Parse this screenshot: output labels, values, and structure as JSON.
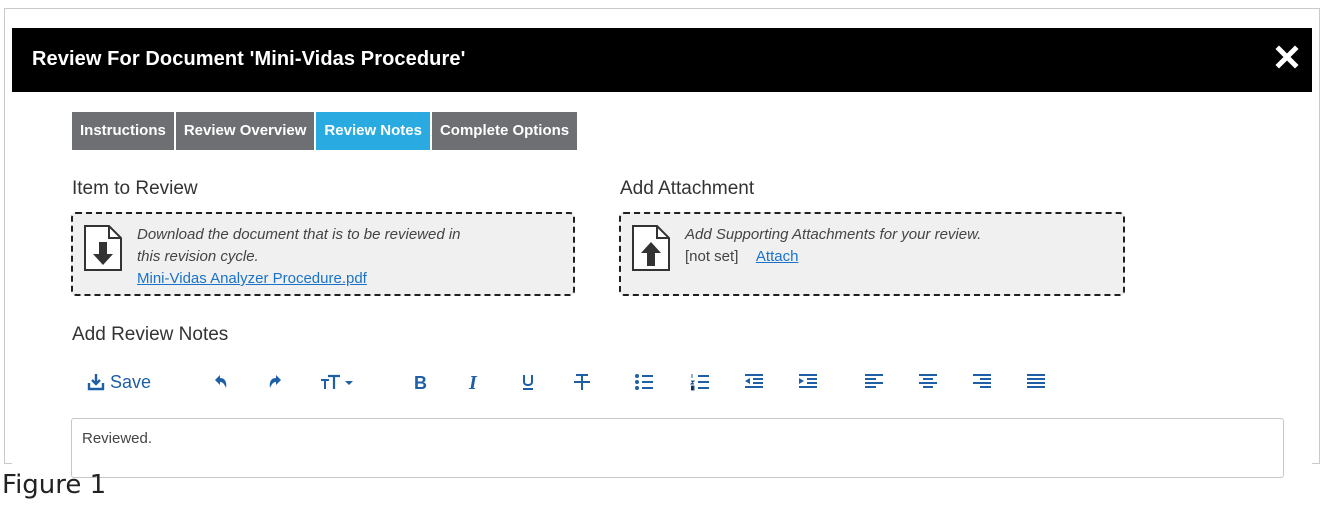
{
  "dialog": {
    "title": "Review For Document 'Mini-Vidas Procedure'",
    "close_icon": "close-icon"
  },
  "tabs": [
    {
      "label": "Instructions",
      "active": false
    },
    {
      "label": "Review Overview",
      "active": false
    },
    {
      "label": "Review Notes",
      "active": true
    },
    {
      "label": "Complete Options",
      "active": false
    }
  ],
  "item_to_review": {
    "heading": "Item to Review",
    "description_line1": "Download the document that is to be reviewed in",
    "description_line2": "this revision cycle.",
    "file_link": "Mini-Vidas Analyzer Procedure.pdf",
    "icon": "download-document-icon"
  },
  "add_attachment": {
    "heading": "Add Attachment",
    "description": "Add Supporting Attachments for your review.",
    "status": "[not set]",
    "attach_link": "Attach",
    "icon": "upload-document-icon"
  },
  "notes": {
    "heading": "Add Review Notes",
    "save_label": "Save",
    "editor_value": "Reviewed.",
    "toolbar_icons": [
      "save-icon",
      "undo-icon",
      "redo-icon",
      "font-size-icon",
      "bold-icon",
      "italic-icon",
      "underline-icon",
      "strikethrough-icon",
      "bulleted-list-icon",
      "numbered-list-icon",
      "outdent-icon",
      "indent-icon",
      "align-left-icon",
      "align-center-icon",
      "align-right-icon",
      "justify-icon"
    ]
  },
  "caption": "Figure 1",
  "colors": {
    "titlebar": "#000000",
    "tab_inactive": "#6d6f73",
    "tab_active": "#29abe2",
    "toolbar_icon": "#1f5fa6",
    "link": "#1a73c9"
  }
}
